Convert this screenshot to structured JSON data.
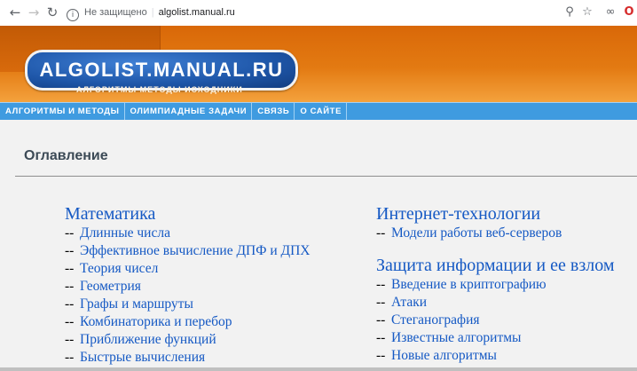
{
  "browser": {
    "security_label": "Не защищено",
    "separator": "|",
    "url": "algolist.manual.ru"
  },
  "header": {
    "logo_text": "ALGOLIST.MANUAL.RU",
    "tagline": "АЛГОРИТМЫ МЕТОДЫ ИСХОДНИКИ"
  },
  "menu": {
    "items": [
      {
        "label": "АЛГОРИТМЫ И МЕТОДЫ"
      },
      {
        "label": "ОЛИМПИАДНЫЕ ЗАДАЧИ"
      },
      {
        "label": "СВЯЗЬ"
      },
      {
        "label": "О САЙТЕ"
      }
    ]
  },
  "content": {
    "section_title": "Оглавление",
    "dash": "--",
    "left": {
      "category": "Математика",
      "items": [
        "Длинные числа",
        "Эффективное вычисление ДПФ и ДПХ",
        "Теория чисел",
        "Геометрия",
        "Графы и маршруты",
        "Комбинаторика и перебор",
        "Приближение функций",
        "Быстрые вычисления"
      ]
    },
    "right": {
      "categories": [
        {
          "title": "Интернет-технологии",
          "items": [
            "Модели работы веб-серверов"
          ]
        },
        {
          "title": "Защита информации и ее взлом",
          "items": [
            "Введение в криптографию",
            "Атаки",
            "Стеганография",
            "Известные алгоритмы",
            "Новые алгоритмы"
          ]
        }
      ]
    }
  },
  "colors": {
    "header_orange": "#e37a12",
    "menu_blue": "#3f9be0",
    "link_blue": "#1559c4",
    "logo_blue": "#1e56a8"
  },
  "icons": [
    "back-arrow-icon",
    "forward-arrow-icon",
    "reload-icon",
    "info-icon",
    "zoom-icon",
    "bookmark-star-icon",
    "extension-icon",
    "opera-icon"
  ]
}
